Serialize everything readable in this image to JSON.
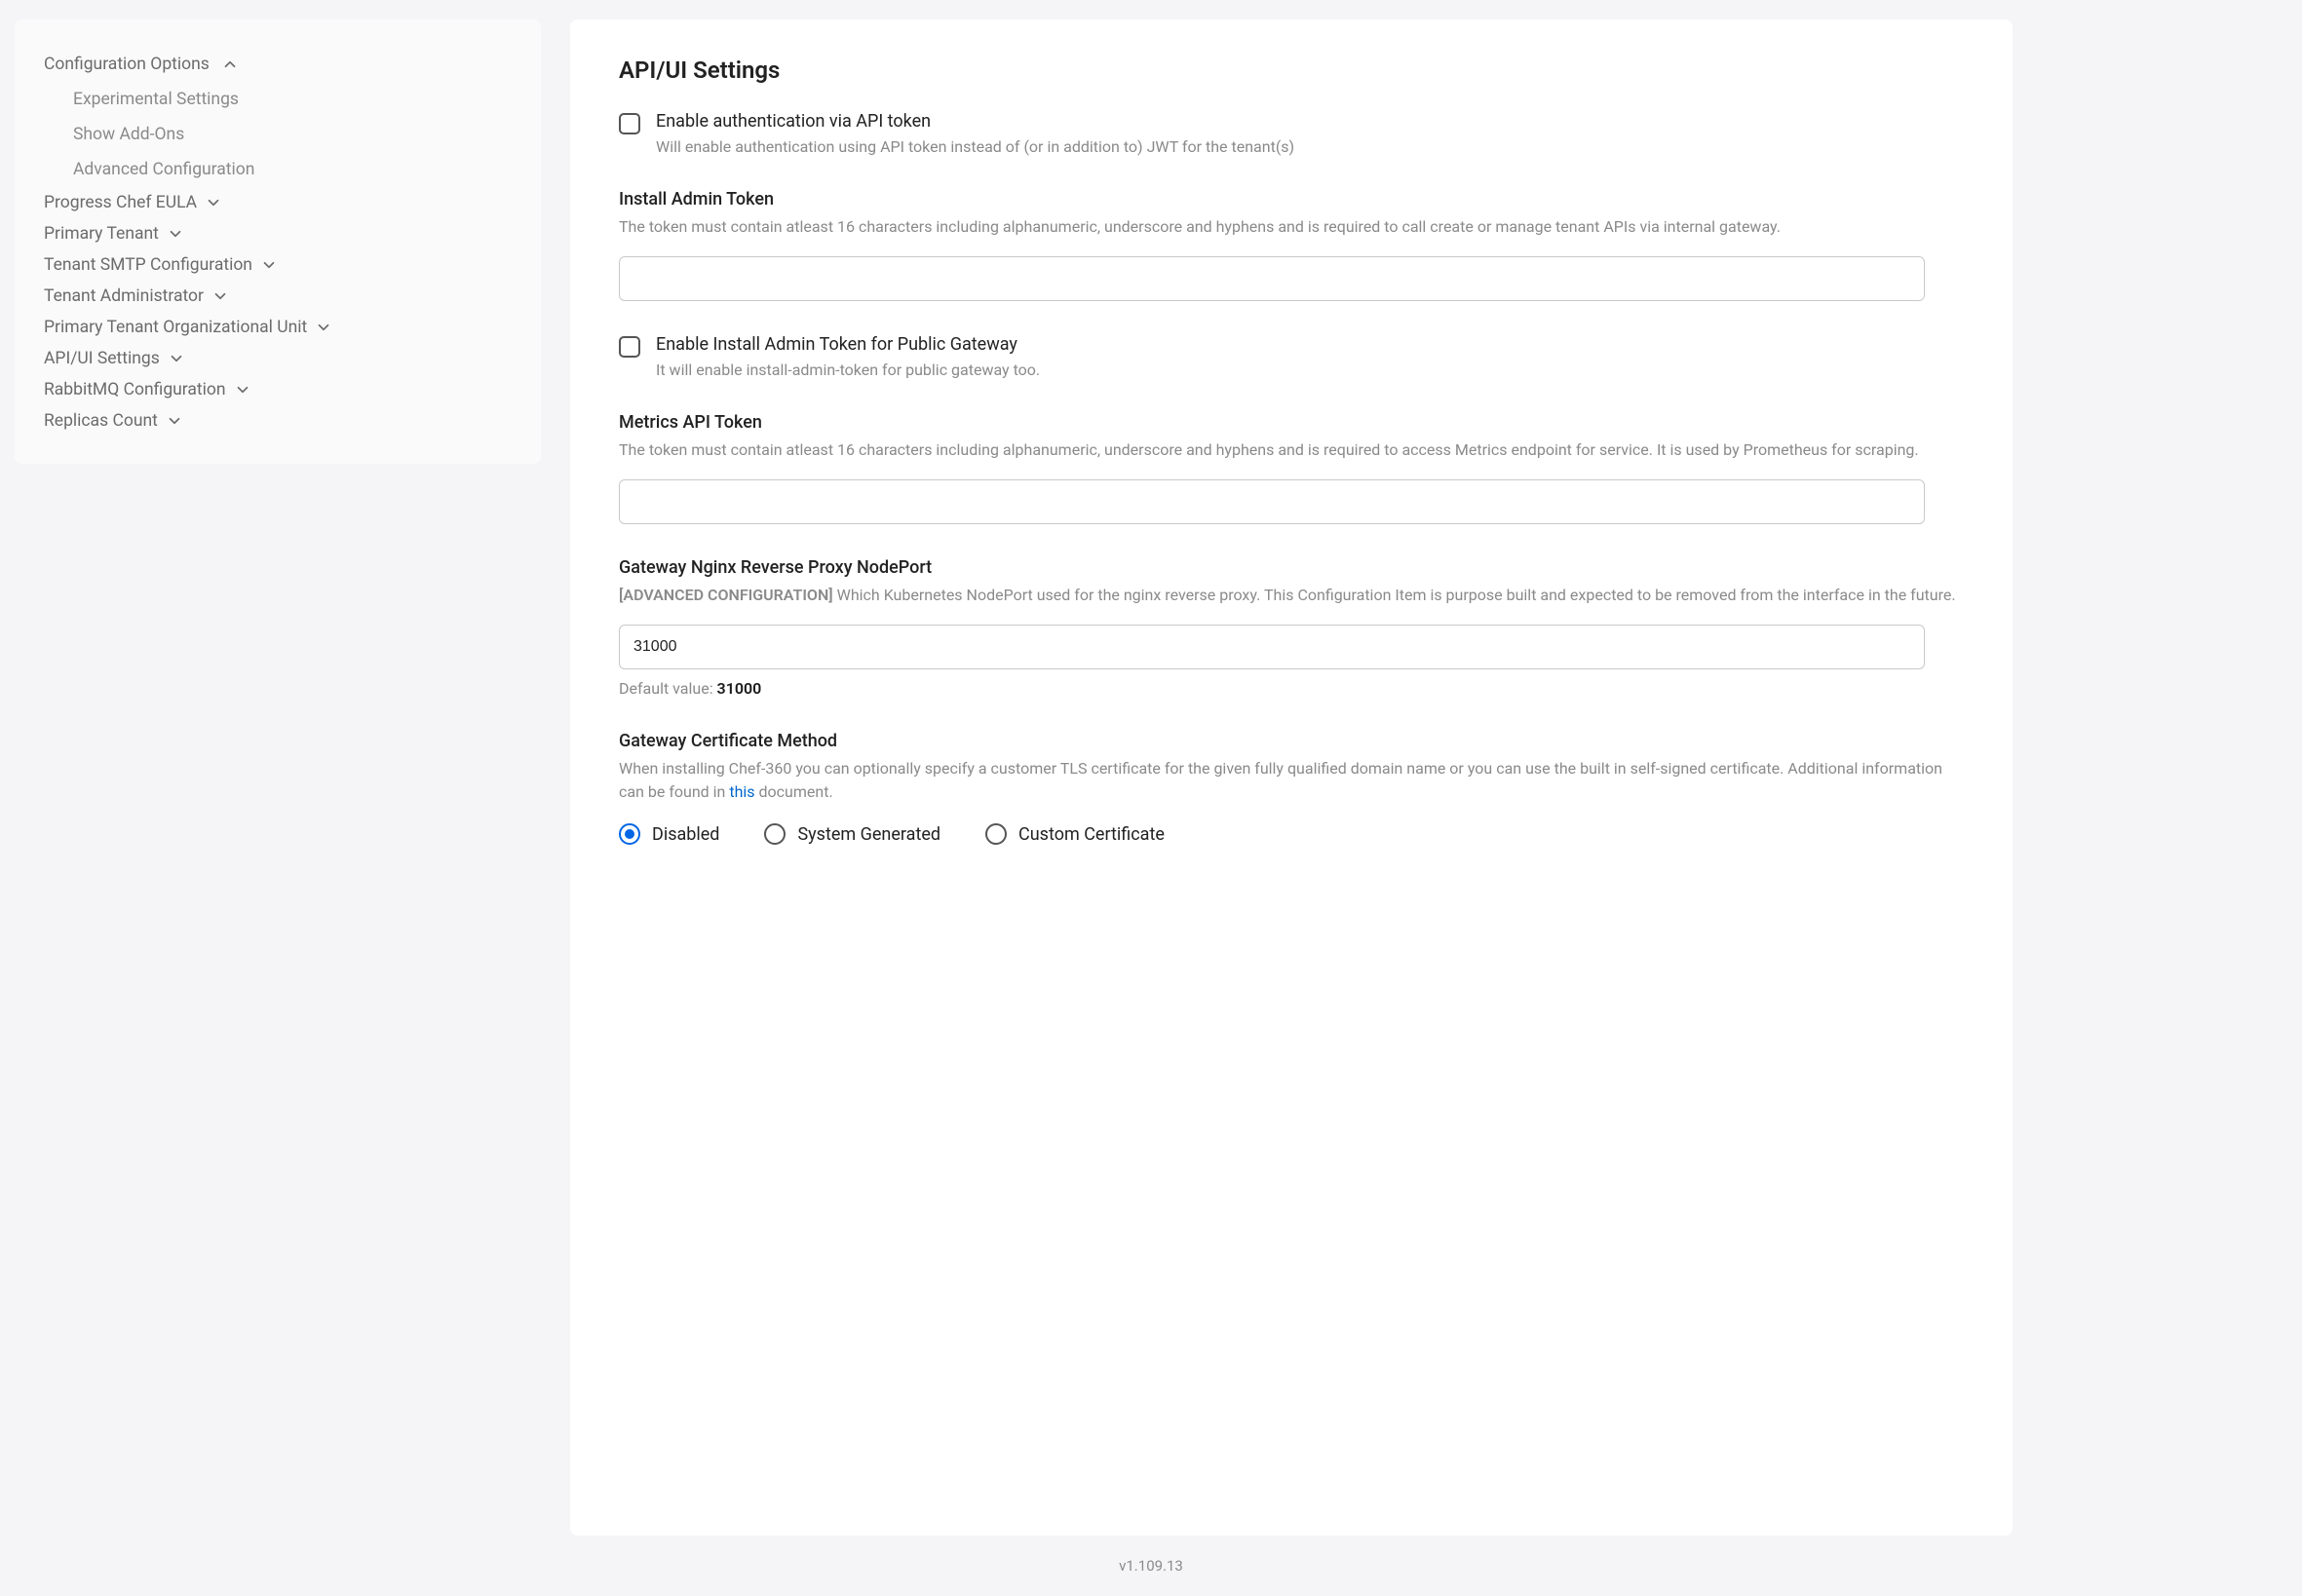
{
  "sidebar": {
    "group_header": "Configuration Options",
    "sub_items": [
      {
        "label": "Experimental Settings"
      },
      {
        "label": "Show Add-Ons"
      },
      {
        "label": "Advanced Configuration"
      }
    ],
    "items": [
      {
        "label": "Progress Chef EULA"
      },
      {
        "label": "Primary Tenant"
      },
      {
        "label": "Tenant SMTP Configuration"
      },
      {
        "label": "Tenant Administrator"
      },
      {
        "label": "Primary Tenant Organizational Unit"
      },
      {
        "label": "API/UI Settings"
      },
      {
        "label": "RabbitMQ Configuration"
      },
      {
        "label": "Replicas Count"
      }
    ]
  },
  "main": {
    "title": "API/UI Settings",
    "enable_api_token": {
      "label": "Enable authentication via API token",
      "desc": "Will enable authentication using API token instead of (or in addition to) JWT for the tenant(s)"
    },
    "install_admin_token": {
      "title": "Install Admin Token",
      "desc": "The token must contain atleast 16 characters including alphanumeric, underscore and hyphens and is required to call create or manage tenant APIs via internal gateway.",
      "value": ""
    },
    "enable_install_admin_public": {
      "label": "Enable Install Admin Token for Public Gateway",
      "desc": "It will enable install-admin-token for public gateway too."
    },
    "metrics_token": {
      "title": "Metrics API Token",
      "desc": "The token must contain atleast 16 characters including alphanumeric, underscore and hyphens and is required to access Metrics endpoint for service. It is used by Prometheus for scraping.",
      "value": ""
    },
    "gateway_nodeport": {
      "title": "Gateway Nginx Reverse Proxy NodePort",
      "adv_tag": "[ADVANCED CONFIGURATION]",
      "desc": "Which Kubernetes NodePort used for the nginx reverse proxy. This Configuration Item is purpose built and expected to be removed from the interface in the future.",
      "value": "31000",
      "default_prefix": "Default value: ",
      "default_value": "31000"
    },
    "cert_method": {
      "title": "Gateway Certificate Method",
      "desc_pre": "When installing Chef-360 you can optionally specify a customer TLS certificate for the given fully qualified domain name or you can use the built in self-signed certificate. Additional information can be found in ",
      "link_text": "this",
      "desc_post": " document.",
      "options": [
        {
          "label": "Disabled",
          "selected": true
        },
        {
          "label": "System Generated",
          "selected": false
        },
        {
          "label": "Custom Certificate",
          "selected": false
        }
      ]
    }
  },
  "footer": {
    "version": "v1.109.13"
  }
}
